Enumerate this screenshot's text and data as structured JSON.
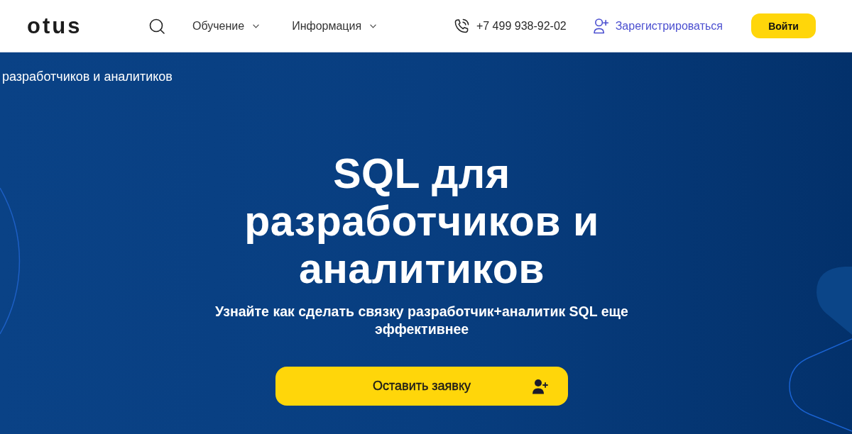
{
  "header": {
    "logo": "otus",
    "nav": [
      {
        "label": "Обучение",
        "dropdown": true
      },
      {
        "label": "Информация",
        "dropdown": true
      }
    ],
    "phone": "+7 499 938-92-02",
    "register_link": "Зарегистрироваться",
    "login_button": "Войти"
  },
  "hero": {
    "breadcrumb": "разработчиков и аналитиков",
    "title": "SQL для разработчиков и аналитиков",
    "subtitle": "Узнайте как сделать связку разработчик+аналитик SQL еще эффективнее",
    "cta_button": "Оставить заявку"
  }
}
